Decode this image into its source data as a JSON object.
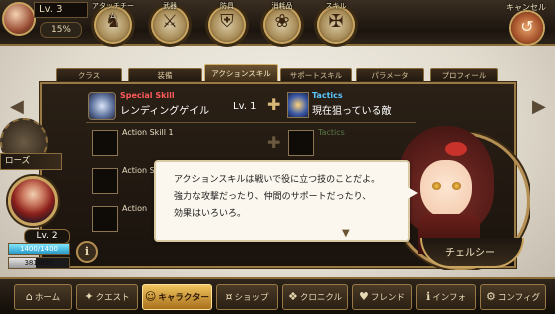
{
  "top": {
    "level": "Lv. 3",
    "exp_percent": "15%",
    "menu": [
      {
        "label": "アタッチチーム",
        "icon": "team-icon",
        "glyph": "♞"
      },
      {
        "label": "武器",
        "icon": "weapon-icon",
        "glyph": "⚔"
      },
      {
        "label": "防具",
        "icon": "armor-icon",
        "glyph": "⛨"
      },
      {
        "label": "消耗品",
        "icon": "consumable-icon",
        "glyph": "❀"
      },
      {
        "label": "スキル",
        "icon": "skill-icon",
        "glyph": "✠"
      }
    ],
    "cancel_label": "キャンセル"
  },
  "tabs": [
    {
      "label": "クラス"
    },
    {
      "label": "装備"
    },
    {
      "label": "アクションスキル",
      "active": true
    },
    {
      "label": "サポートスキル"
    },
    {
      "label": "パラメータ"
    },
    {
      "label": "プロフィール"
    }
  ],
  "special": {
    "title": "Special Skill",
    "name": "レンディングゲイル",
    "level": "Lv. 1",
    "tactics_title": "Tactics",
    "tactics_name": "現在狙っている敵"
  },
  "action_skills": [
    {
      "label": "Action Skill 1",
      "tactics": "Tactics"
    },
    {
      "label": "Action S"
    },
    {
      "label": "Action"
    }
  ],
  "character": {
    "name": "ローズ",
    "level": "Lv. 2",
    "hp": "1400/1400",
    "hp_fraction": 1.0,
    "exp": "381/850",
    "exp_fraction": 0.45
  },
  "dialog": {
    "lines": [
      "アクションスキルは戦いで役に立つ技のことだよ。",
      "強力な攻撃だったり、仲間のサポートだったり、",
      "効果はいろいろ。"
    ],
    "speaker": "チェルシー"
  },
  "bottom_nav": [
    {
      "label": "ホーム",
      "glyph": "⌂"
    },
    {
      "label": "クエスト",
      "glyph": "✦"
    },
    {
      "label": "キャラクター",
      "glyph": "☺",
      "active": true
    },
    {
      "label": "ショップ",
      "glyph": "¤"
    },
    {
      "label": "クロニクル",
      "glyph": "❖"
    },
    {
      "label": "フレンド",
      "glyph": "♥"
    },
    {
      "label": "インフォ",
      "glyph": "ℹ"
    },
    {
      "label": "コンフィグ",
      "glyph": "⚙"
    }
  ],
  "colors": {
    "accent": "#c9a45f",
    "special": "#ff5a5a",
    "tactics": "#59c7ff",
    "active_nav": "#f0c45e"
  }
}
